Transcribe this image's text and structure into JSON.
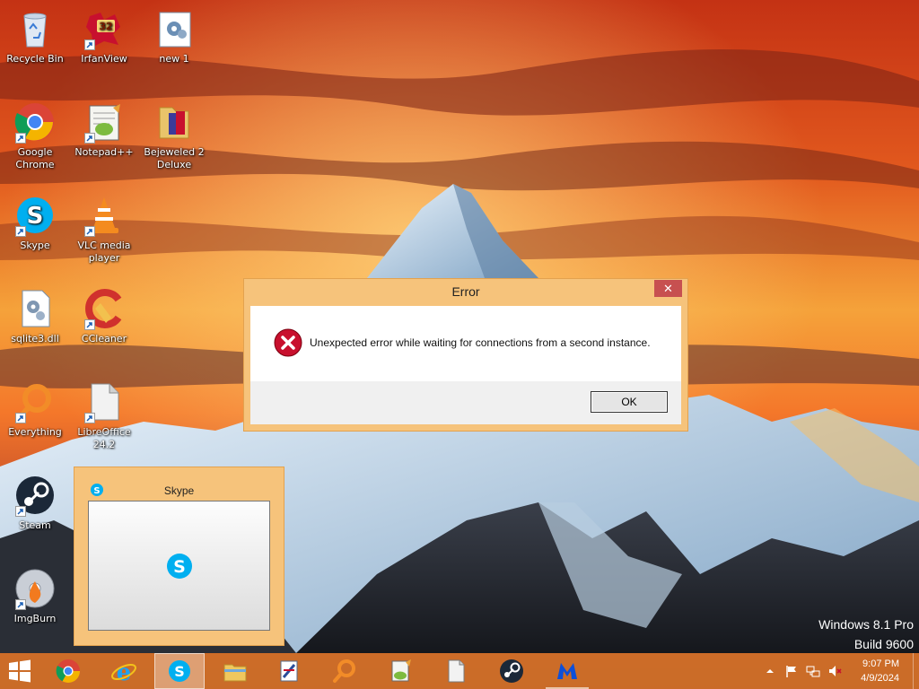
{
  "desktop": {
    "icons": [
      {
        "label": "Recycle Bin",
        "icon": "recycle-bin-icon"
      },
      {
        "label": "IrfanView",
        "icon": "irfanview-icon",
        "badge": "32"
      },
      {
        "label": "new 1",
        "icon": "config-file-icon"
      },
      {
        "label": "Google Chrome",
        "icon": "chrome-icon"
      },
      {
        "label": "Notepad++",
        "icon": "notepadpp-icon"
      },
      {
        "label": "Bejeweled 2 Deluxe",
        "icon": "folder-icon"
      },
      {
        "label": "Skype",
        "icon": "skype-icon"
      },
      {
        "label": "VLC media player",
        "icon": "vlc-icon"
      },
      {
        "label": "sqlite3.dll",
        "icon": "dll-file-icon"
      },
      {
        "label": "CCleaner",
        "icon": "ccleaner-icon"
      },
      {
        "label": "Everything",
        "icon": "everything-icon"
      },
      {
        "label": "LibreOffice 24.2",
        "icon": "libreoffice-icon"
      },
      {
        "label": "Steam",
        "icon": "steam-icon"
      },
      {
        "label": "ImgBurn",
        "icon": "imgburn-icon"
      }
    ]
  },
  "dialog": {
    "title": "Error",
    "close_label": "✕",
    "message": "Unexpected error while waiting for connections from a second instance.",
    "ok_label": "OK",
    "icon": "error-icon"
  },
  "thumbnail": {
    "title": "Skype",
    "icon": "skype-icon"
  },
  "watermark": {
    "line1": "Windows 8.1 Pro",
    "line2": "Build 9600"
  },
  "taskbar": {
    "buttons": [
      {
        "icon": "start-windows-icon"
      },
      {
        "icon": "chrome-icon"
      },
      {
        "icon": "internet-explorer-icon"
      },
      {
        "icon": "skype-icon",
        "state": "active"
      },
      {
        "icon": "file-explorer-icon"
      },
      {
        "icon": "installer-icon"
      },
      {
        "icon": "everything-search-icon"
      },
      {
        "icon": "notepadpp-icon"
      },
      {
        "icon": "libreoffice-icon"
      },
      {
        "icon": "steam-icon"
      },
      {
        "icon": "malwarebytes-icon",
        "state": "running"
      }
    ],
    "tray": {
      "icons": [
        "show-hidden-icons-chevron",
        "action-center-flag-icon",
        "network-icon",
        "volume-muted-icon"
      ],
      "time": "9:07 PM",
      "date": "4/9/2024"
    }
  },
  "colors": {
    "taskbar": "#e07a28",
    "dialog_frame": "#f6c37b",
    "close_button": "#c75050",
    "skype_blue": "#00aff0",
    "error_red": "#c8102e"
  }
}
